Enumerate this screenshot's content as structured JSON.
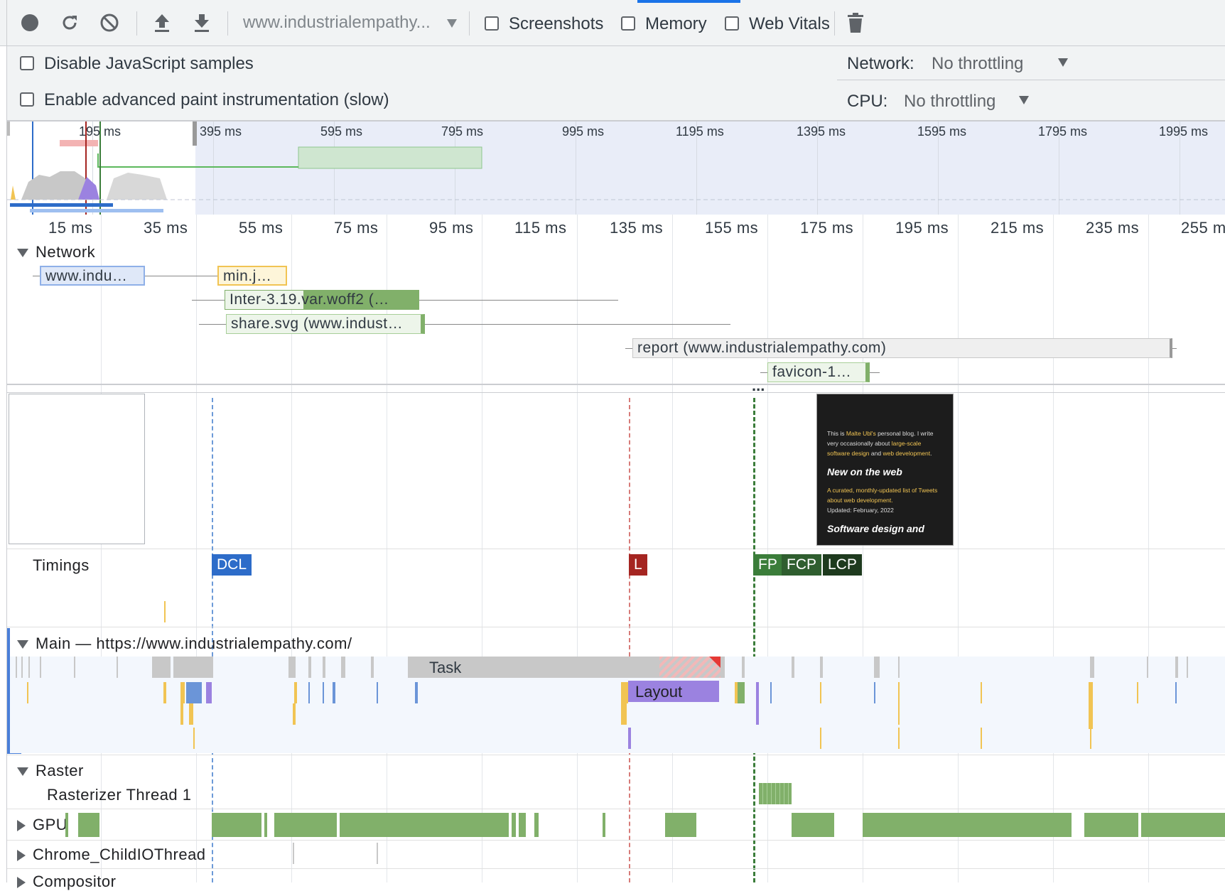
{
  "toolbar": {
    "url_select": "www.industrialempathy...",
    "checkboxes": [
      {
        "label": "Screenshots",
        "checked": false
      },
      {
        "label": "Memory",
        "checked": false
      },
      {
        "label": "Web Vitals",
        "checked": false
      }
    ]
  },
  "settings": {
    "disable_js_samples": "Disable JavaScript samples",
    "advanced_paint": "Enable advanced paint instrumentation (slow)",
    "network_label": "Network:",
    "network_value": "No throttling",
    "cpu_label": "CPU:",
    "cpu_value": "No throttling"
  },
  "overview": {
    "ticks": [
      "195 ms",
      "395 ms",
      "595 ms",
      "795 ms",
      "995 ms",
      "1195 ms",
      "1395 ms",
      "1595 ms",
      "1795 ms",
      "1995 ms"
    ]
  },
  "ruler": {
    "ticks": [
      "15 ms",
      "35 ms",
      "55 ms",
      "75 ms",
      "95 ms",
      "115 ms",
      "135 ms",
      "155 ms",
      "175 ms",
      "195 ms",
      "215 ms",
      "235 ms",
      "255 m"
    ]
  },
  "network": {
    "title": "Network",
    "requests": [
      {
        "label": "www.indu…"
      },
      {
        "label": "min.j…"
      },
      {
        "label": "Inter-3.19.var.woff2 (…"
      },
      {
        "label": "share.svg (www.indust…"
      },
      {
        "label": "report (www.industrialempathy.com)"
      },
      {
        "label": "favicon-1…"
      }
    ],
    "more": "..."
  },
  "screenshot_preview": {
    "intro_prefix": "This is ",
    "intro_name": "Malte Ubl's",
    "intro_mid": " personal blog. I write very occasionally about ",
    "intro_link1": "large-scale software design",
    "intro_and": " and ",
    "intro_link2": "web development",
    "intro_end": ".",
    "heading1": "New on the web",
    "curated": "A curated, monthly-updated list of Tweets about web development.",
    "updated": "Updated: February, 2022",
    "heading2": "Software design and"
  },
  "timings": {
    "title": "Timings",
    "markers": [
      "DCL",
      "L",
      "FP",
      "FCP",
      "LCP"
    ]
  },
  "main": {
    "title": "Main — https://www.industrialempathy.com/",
    "task_label": "Task",
    "layout_label": "Layout"
  },
  "raster": {
    "title": "Raster",
    "thread": "Rasterizer Thread 1"
  },
  "gpu": {
    "title": "GPU"
  },
  "io": {
    "title": "Chrome_ChildIOThread"
  },
  "compositor": {
    "title": "Compositor"
  },
  "colors": {
    "dcl": "#2d6cc9",
    "load": "#a52521",
    "fp": "#3b7d3a",
    "fcp": "#2f5e2f",
    "lcp": "#1e3a1e",
    "gpu": "#81b06a",
    "task": "#c8c8c8",
    "layout": "#9b82e0"
  }
}
